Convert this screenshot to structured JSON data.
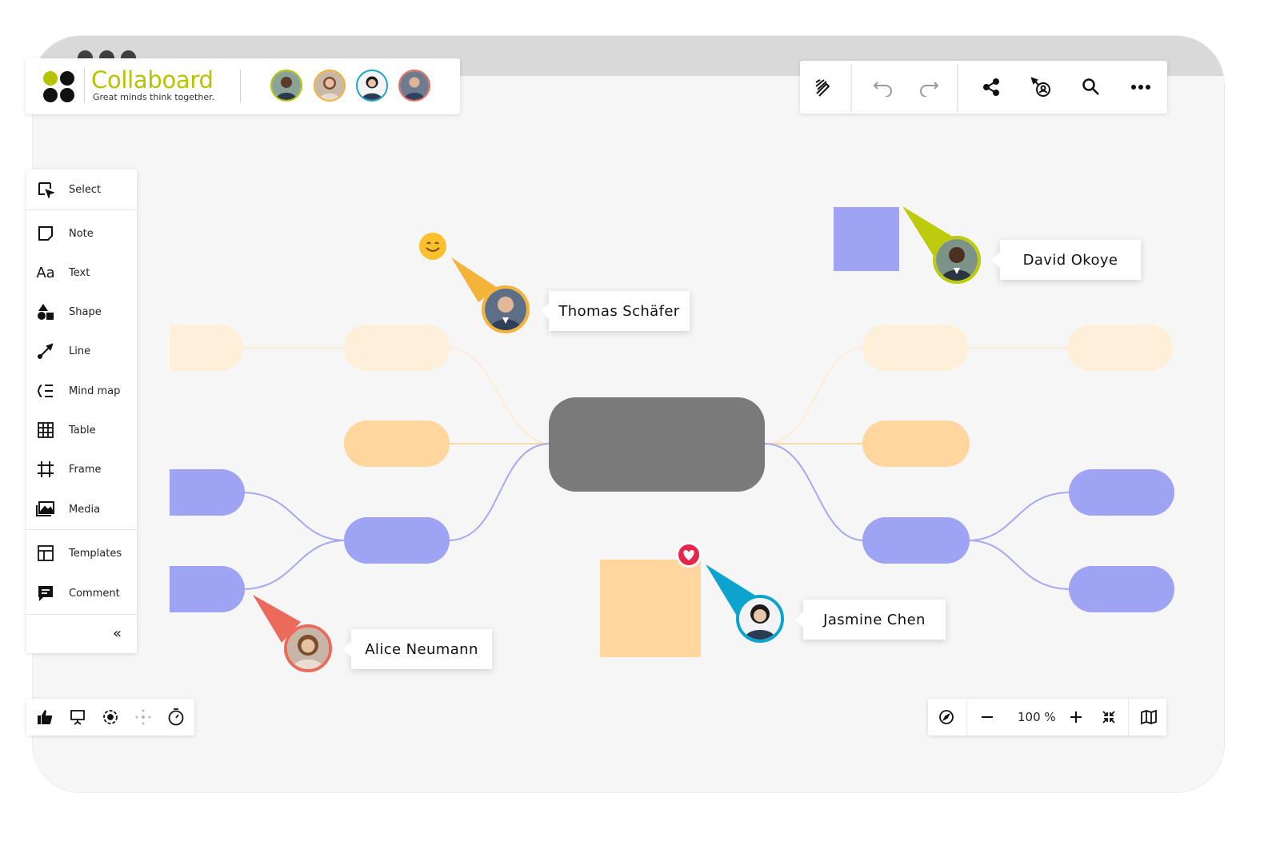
{
  "window": {
    "dots": 3
  },
  "brand": {
    "name": "Collaboard",
    "tagline": "Great minds think together.",
    "accent": "#b6c300",
    "collaborators": [
      {
        "name": "collaborator-1",
        "ring": "#b6c300"
      },
      {
        "name": "collaborator-2",
        "ring": "#f0b030"
      },
      {
        "name": "collaborator-3",
        "ring": "#16a3c9"
      },
      {
        "name": "collaborator-4",
        "ring": "#ea6b5e"
      }
    ]
  },
  "toolbar": {
    "items": [
      "pen-eraser-icon",
      "undo-icon",
      "redo-icon",
      "share-icon",
      "follow-user-icon",
      "search-icon",
      "more-icon"
    ]
  },
  "sidebar": {
    "items": [
      {
        "label": "Select",
        "icon": "select-icon"
      },
      {
        "label": "Note",
        "icon": "note-icon"
      },
      {
        "label": "Text",
        "icon": "text-icon"
      },
      {
        "label": "Shape",
        "icon": "shape-icon"
      },
      {
        "label": "Line",
        "icon": "line-icon"
      },
      {
        "label": "Mind map",
        "icon": "mind-map-icon"
      },
      {
        "label": "Table",
        "icon": "table-icon"
      },
      {
        "label": "Frame",
        "icon": "frame-icon"
      },
      {
        "label": "Media",
        "icon": "media-icon"
      },
      {
        "label": "Templates",
        "icon": "templates-icon"
      },
      {
        "label": "Comment",
        "icon": "comment-icon"
      }
    ],
    "collapse_label": "«"
  },
  "bottom_left": {
    "items": [
      "thumbs-up-icon",
      "presentation-icon",
      "focus-icon",
      "spread-icon",
      "timer-icon"
    ]
  },
  "zoom": {
    "value": "100 %",
    "items": [
      "compass-icon",
      "zoom-out-icon",
      "zoom-in-icon",
      "fit-icon",
      "map-icon"
    ]
  },
  "users": [
    {
      "name": "Thomas Schäfer",
      "color": "#f4b43a",
      "reaction": "smile-emoji-icon"
    },
    {
      "name": "David Okoye",
      "color": "#bccb0b"
    },
    {
      "name": "Jasmine Chen",
      "color": "#0ca4cf",
      "reaction": "heart-icon"
    },
    {
      "name": "Alice Neumann",
      "color": "#eb6a5c"
    }
  ],
  "colors": {
    "center": "#7a7a7a",
    "orange_light": "#feefd9",
    "orange": "#fed69e",
    "purple": "#9fa3f3",
    "purple_line": "#a6a9ef",
    "orange_line": "#fcd9a5"
  }
}
